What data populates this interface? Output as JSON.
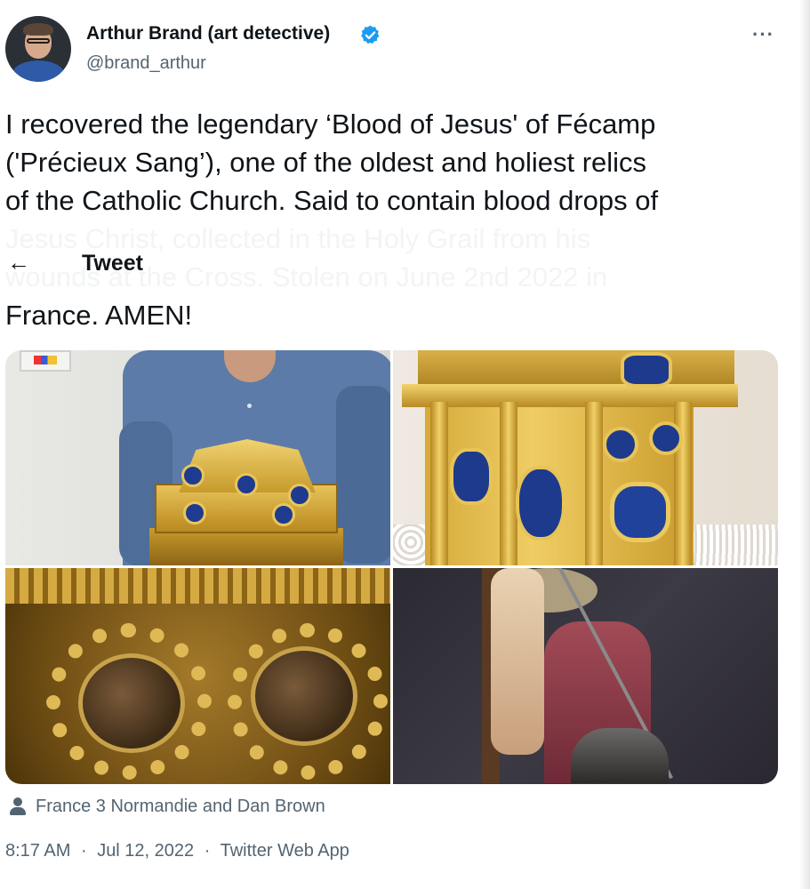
{
  "author": {
    "name": "Arthur Brand (art detective)",
    "handle": "@brand_arthur",
    "verified": true
  },
  "menu": {
    "more_label": "···"
  },
  "tweet": {
    "lines": [
      "I recovered the legendary ‘Blood of Jesus' of Fécamp",
      "('Précieux Sang’), one of the oldest and holiest relics",
      "of the Catholic Church. Said to contain blood drops of",
      "Jesus Christ, collected in the Holy Grail from his",
      "wounds at the Cross. Stolen on June 2nd 2022 in",
      "France. AMEN!"
    ]
  },
  "nav": {
    "back_icon": "←",
    "title": "Tweet"
  },
  "media": {
    "attribution": "France 3 Normandie and Dan Brown"
  },
  "meta": {
    "time": "8:17 AM",
    "date": "Jul 12, 2022",
    "separator": "·",
    "source": "Twitter Web App"
  },
  "colors": {
    "text": "#0f1419",
    "secondary": "#536471",
    "verified": "#1d9bf0"
  }
}
